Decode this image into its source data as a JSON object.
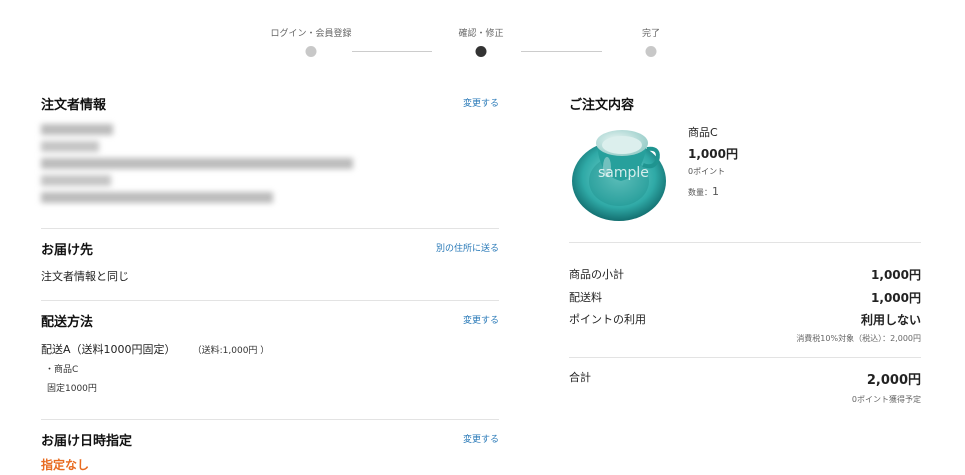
{
  "stepper": {
    "steps": [
      {
        "label": "ログイン・会員登録"
      },
      {
        "label": "確認・修正"
      },
      {
        "label": "完了"
      }
    ]
  },
  "orderer": {
    "title": "注文者情報",
    "change_link": "変更する",
    "lines": [
      "",
      "",
      " ",
      "",
      ""
    ]
  },
  "shipping_address": {
    "title": "お届け先",
    "link": "別の住所に送る",
    "value": "注文者情報と同じ"
  },
  "delivery_method": {
    "title": "配送方法",
    "change_link": "変更する",
    "method": "配送A（送料1000円固定）",
    "fee": "（送料:1,000円 ）",
    "item": "・商品C",
    "note": "固定1000円"
  },
  "delivery_time": {
    "title": "お届け日時指定",
    "change_link": "変更する",
    "value": "指定なし"
  },
  "order": {
    "title": "ご注文内容",
    "product": {
      "name": "商品C",
      "price": "1,000円",
      "points": "0ポイント",
      "qty_label": "数量：",
      "qty": "1",
      "image_watermark": "sample"
    },
    "subtotal_label": "商品の小計",
    "subtotal": "1,000円",
    "shipping_label": "配送料",
    "shipping": "1,000円",
    "points_label": "ポイントの利用",
    "points_value": "利用しない",
    "tax_note": "消費税10%対象（税込）：2,000円",
    "total_label": "合計",
    "total": "2,000円",
    "points_earn": "0ポイント獲得予定"
  }
}
